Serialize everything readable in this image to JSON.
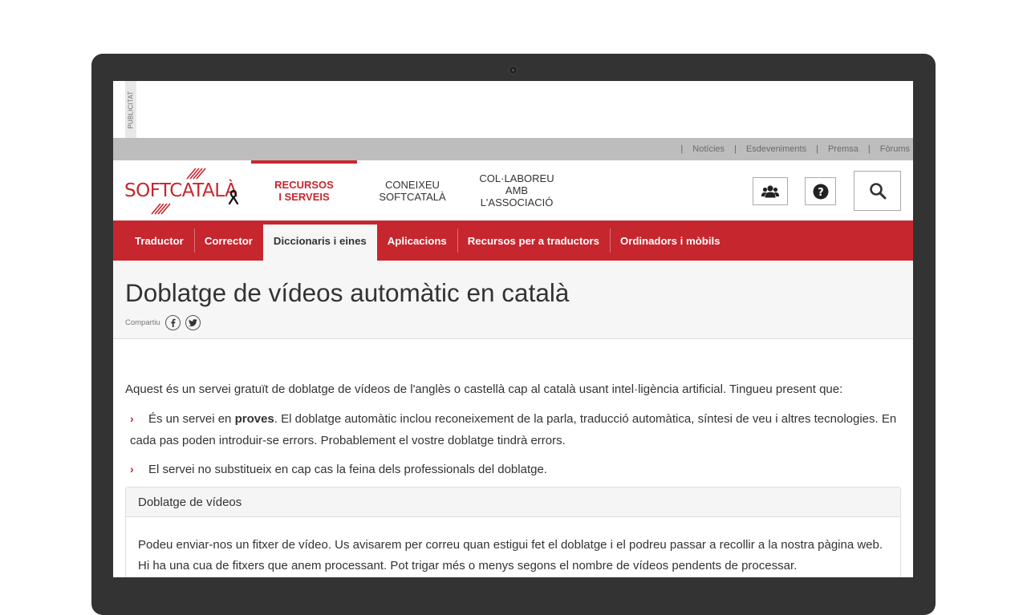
{
  "ad": {
    "label": "PUBLICITAT"
  },
  "toplinks": [
    "Notícies",
    "Esdeveniments",
    "Premsa",
    "Fòrums"
  ],
  "toplinks_separator": "|",
  "logo": {
    "text": "SOFTCATALÀ"
  },
  "mainnav": [
    {
      "label": "RECURSOS\nI SERVEIS",
      "active": true
    },
    {
      "label": "CONEIXEU\nSOFTCATALÀ",
      "active": false
    },
    {
      "label": "COL·LABOREU\nAMB L'ASSOCIACIÓ",
      "active": false
    }
  ],
  "header_buttons": {
    "users_icon": "users-icon",
    "help_icon": "question-circle-icon",
    "search_icon": "search-icon"
  },
  "subnav": [
    {
      "label": "Traductor",
      "active": false
    },
    {
      "label": "Corrector",
      "active": false
    },
    {
      "label": "Diccionaris i eines",
      "active": true
    },
    {
      "label": "Aplicacions",
      "active": false
    },
    {
      "label": "Recursos per a traductors",
      "active": false
    },
    {
      "label": "Ordinadors i mòbils",
      "active": false
    }
  ],
  "page": {
    "title": "Doblatge de vídeos automàtic en català",
    "share_label": "Compartiu",
    "share_icons": [
      "facebook-icon",
      "twitter-icon"
    ]
  },
  "content": {
    "intro": "Aquest és un servei gratuït de doblatge de vídeos de l'anglès o castellà cap al català usant intel·ligència artificial. Tingueu present que:",
    "bullet1_pre": "És un servei en ",
    "bullet1_bold": "proves",
    "bullet1_post": ". El doblatge automàtic inclou reconeixement de la parla, traducció automàtica, síntesi de veu i altres tecnologies. En cada pas poden introduir-se errors. Probablement el vostre doblatge tindrà errors.",
    "bullet2": "El servei no substitueix en cap cas la feina dels professionals del doblatge."
  },
  "panel": {
    "title": "Doblatge de vídeos",
    "body": "Podeu enviar-nos un fitxer de vídeo. Us avisarem per correu quan estigui fet el doblatge i el podreu passar a recollir a la nostra pàgina web. Hi ha una cua de fitxers que anem processant. Pot trigar més o menys segons el nombre de vídeos pendents de processar."
  },
  "colors": {
    "brand_red": "#c6262e",
    "device": "#333333",
    "topbar": "#bdbdbd",
    "title_band": "#f6f6f6"
  }
}
